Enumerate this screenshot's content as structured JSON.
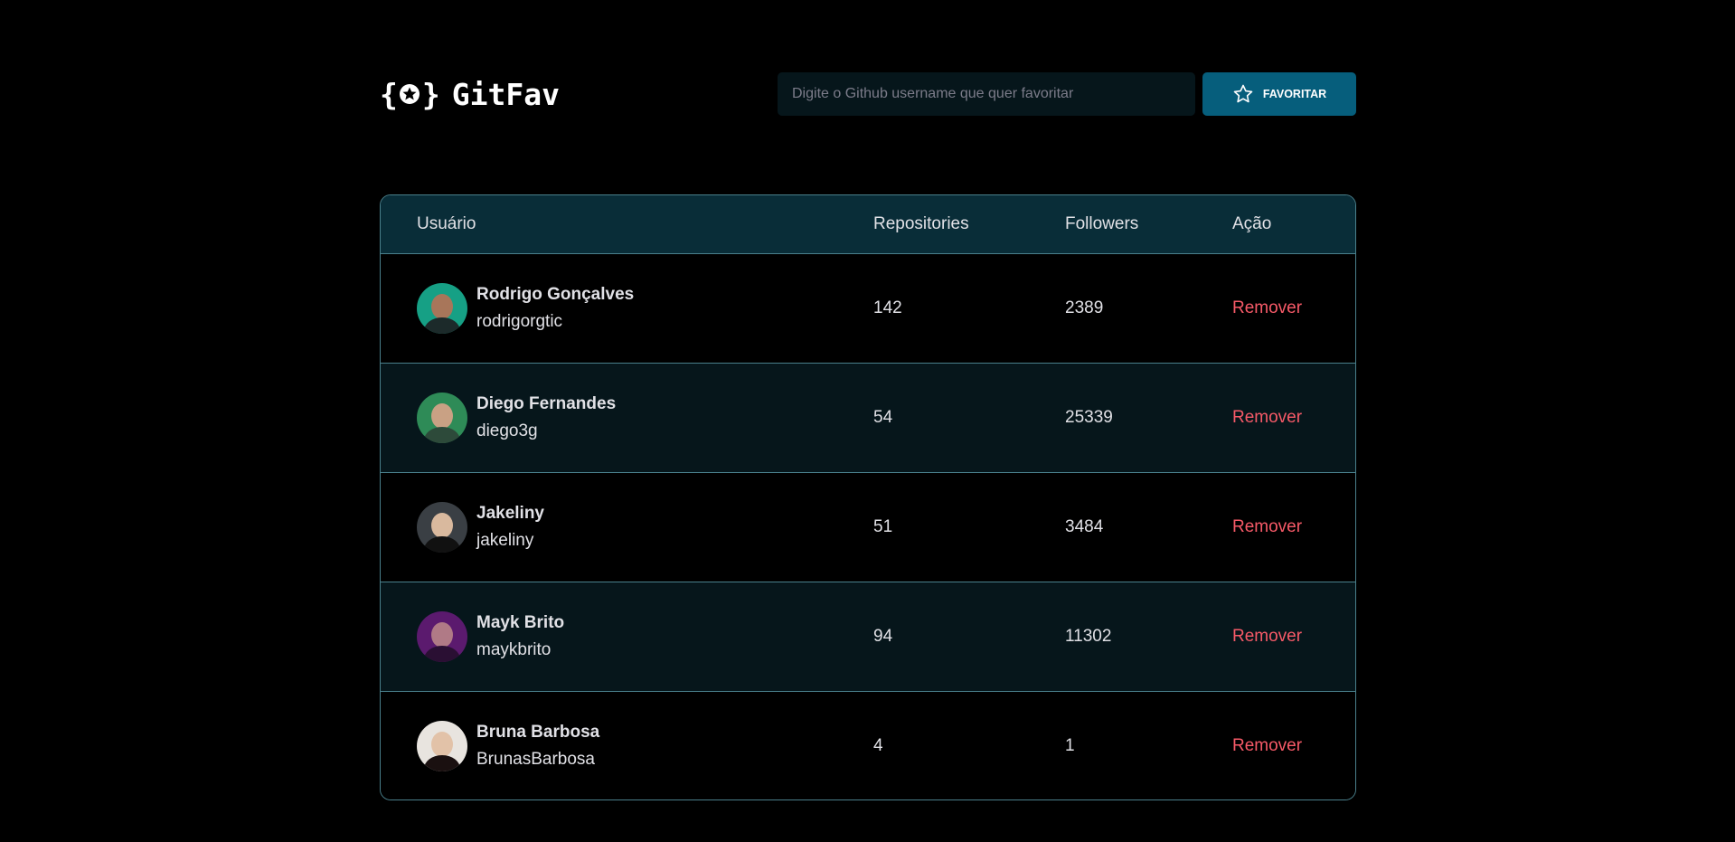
{
  "app": {
    "logo_text": "GitFav"
  },
  "search": {
    "placeholder": "Digite o Github username que quer favoritar",
    "value": ""
  },
  "favorite_button": {
    "label": "FAVORITAR"
  },
  "table": {
    "headers": {
      "user": "Usuário",
      "repositories": "Repositories",
      "followers": "Followers",
      "action": "Ação"
    },
    "rows": [
      {
        "name": "Rodrigo Gonçalves",
        "login": "rodrigorgtic",
        "repositories": "142",
        "followers": "2389",
        "action": "Remover",
        "avatar_bg": "#16a085"
      },
      {
        "name": "Diego Fernandes",
        "login": "diego3g",
        "repositories": "54",
        "followers": "25339",
        "action": "Remover",
        "avatar_bg": "#2e8b57"
      },
      {
        "name": "Jakeliny",
        "login": "jakeliny",
        "repositories": "51",
        "followers": "3484",
        "action": "Remover",
        "avatar_bg": "#3a3f44"
      },
      {
        "name": "Mayk Brito",
        "login": "maykbrito",
        "repositories": "94",
        "followers": "11302",
        "action": "Remover",
        "avatar_bg": "#5b1a6e"
      },
      {
        "name": "Bruna Barbosa",
        "login": "BrunasBarbosa",
        "repositories": "4",
        "followers": "1",
        "action": "Remover",
        "avatar_bg": "#e8e4df"
      }
    ]
  },
  "colors": {
    "background": "#000000",
    "header_row": "#092D38",
    "row_alt": "#06161B",
    "border": "#4A808C",
    "button": "#065E7C",
    "remove": "#F75A68"
  },
  "icons": {
    "logo": "braces-star-icon",
    "favorite": "star-outline-icon"
  }
}
